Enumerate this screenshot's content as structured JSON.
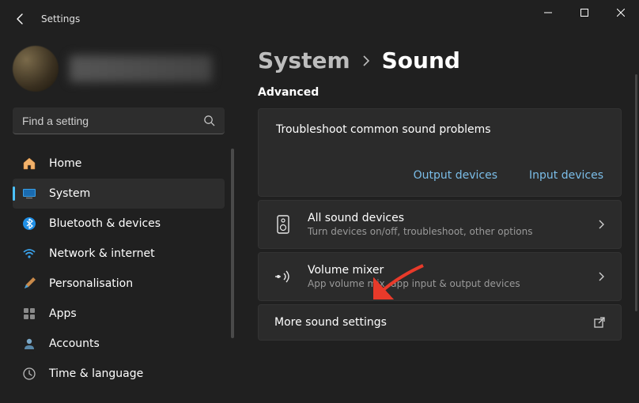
{
  "window": {
    "title": "Settings"
  },
  "search": {
    "placeholder": "Find a setting"
  },
  "nav": [
    {
      "key": "home",
      "label": "Home"
    },
    {
      "key": "system",
      "label": "System"
    },
    {
      "key": "bt",
      "label": "Bluetooth & devices"
    },
    {
      "key": "net",
      "label": "Network & internet"
    },
    {
      "key": "pers",
      "label": "Personalisation"
    },
    {
      "key": "apps",
      "label": "Apps"
    },
    {
      "key": "acct",
      "label": "Accounts"
    },
    {
      "key": "time",
      "label": "Time & language"
    }
  ],
  "breadcrumb": {
    "parent": "System",
    "current": "Sound"
  },
  "section_label": "Advanced",
  "troubleshoot": {
    "title": "Troubleshoot common sound problems",
    "link_output": "Output devices",
    "link_input": "Input devices"
  },
  "rows": {
    "all_devices": {
      "title": "All sound devices",
      "sub": "Turn devices on/off, troubleshoot, other options"
    },
    "mixer": {
      "title": "Volume mixer",
      "sub": "App volume mix, app input & output devices"
    },
    "more": {
      "title": "More sound settings"
    }
  }
}
